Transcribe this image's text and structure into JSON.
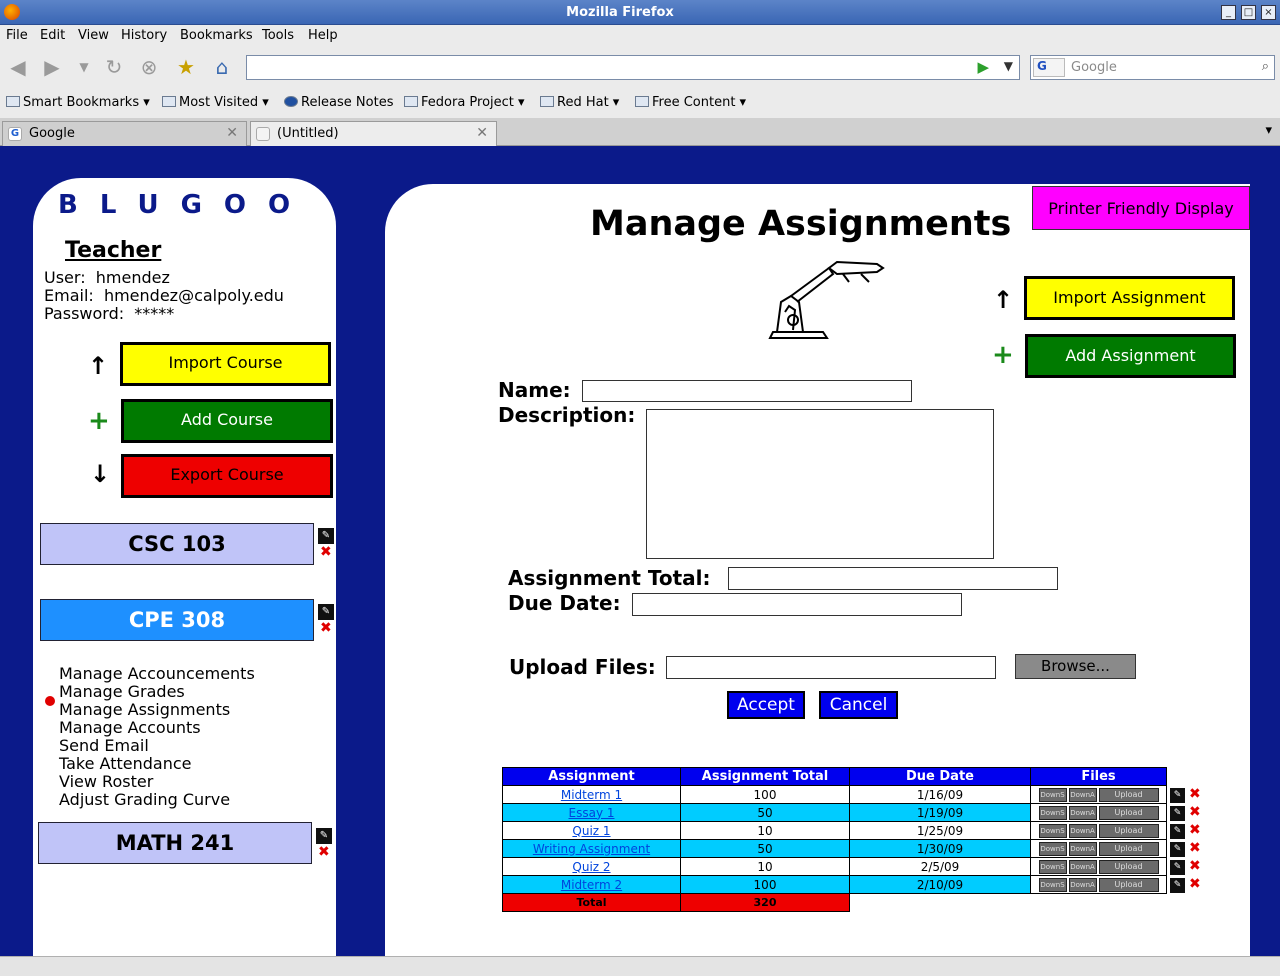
{
  "window": {
    "title": "Mozilla Firefox"
  },
  "menubar": [
    "File",
    "Edit",
    "View",
    "History",
    "Bookmarks",
    "Tools",
    "Help"
  ],
  "search": {
    "placeholder": "Google",
    "engine": "G"
  },
  "bookmarks": [
    "Smart Bookmarks",
    "Most Visited",
    "Release Notes",
    "Fedora Project",
    "Red Hat",
    "Free Content"
  ],
  "tabs": [
    {
      "label": "Google"
    },
    {
      "label": "(Untitled)"
    }
  ],
  "sidebar": {
    "logo": "BLUGOO",
    "role": "Teacher",
    "user_label": "User:",
    "user": "hmendez",
    "email_label": "Email:",
    "email": "hmendez@calpoly.edu",
    "password_label": "Password:",
    "password": "*****",
    "import_course": "Import Course",
    "add_course": "Add Course",
    "export_course": "Export Course",
    "courses": [
      "CSC 103",
      "CPE 308",
      "MATH 241"
    ],
    "menu": [
      "Manage Accouncements",
      "Manage Grades",
      "Manage Assignments",
      "Manage Accounts",
      "Send Email",
      "Take Attendance",
      "View Roster",
      "Adjust Grading Curve"
    ]
  },
  "main": {
    "title": "Manage Assignments",
    "printer_friendly": "Printer Friendly Display",
    "import_assignment": "Import Assignment",
    "add_assignment": "Add Assignment",
    "name_label": "Name:",
    "description_label": "Description:",
    "total_label": "Assignment Total:",
    "due_label": "Due Date:",
    "upload_label": "Upload Files:",
    "browse": "Browse...",
    "accept": "Accept",
    "cancel": "Cancel"
  },
  "table": {
    "headers": [
      "Assignment",
      "Assignment Total",
      "Due Date",
      "Files"
    ],
    "rows": [
      {
        "name": "Midterm 1",
        "total": "100",
        "due": "1/16/09"
      },
      {
        "name": "Essay 1",
        "total": "50",
        "due": "1/19/09"
      },
      {
        "name": "Quiz 1",
        "total": "10",
        "due": "1/25/09"
      },
      {
        "name": "Writing Assignment",
        "total": "50",
        "due": "1/30/09"
      },
      {
        "name": "Quiz 2",
        "total": "10",
        "due": "2/5/09"
      },
      {
        "name": "Midterm 2",
        "total": "100",
        "due": "2/10/09"
      }
    ],
    "file_buttons": [
      "DownS",
      "DownA",
      "Upload"
    ],
    "total_label": "Total",
    "total_value": "320"
  },
  "colors": {
    "page_bg": "#0b1a8a",
    "yellow": "#ffff00",
    "green": "#007a00",
    "red": "#ee0000",
    "course_light": "#c0c4f8",
    "course_active": "#1e90ff",
    "header_blue": "#0000ee",
    "row_cyan": "#00ccff",
    "printer": "#ff00ff"
  }
}
